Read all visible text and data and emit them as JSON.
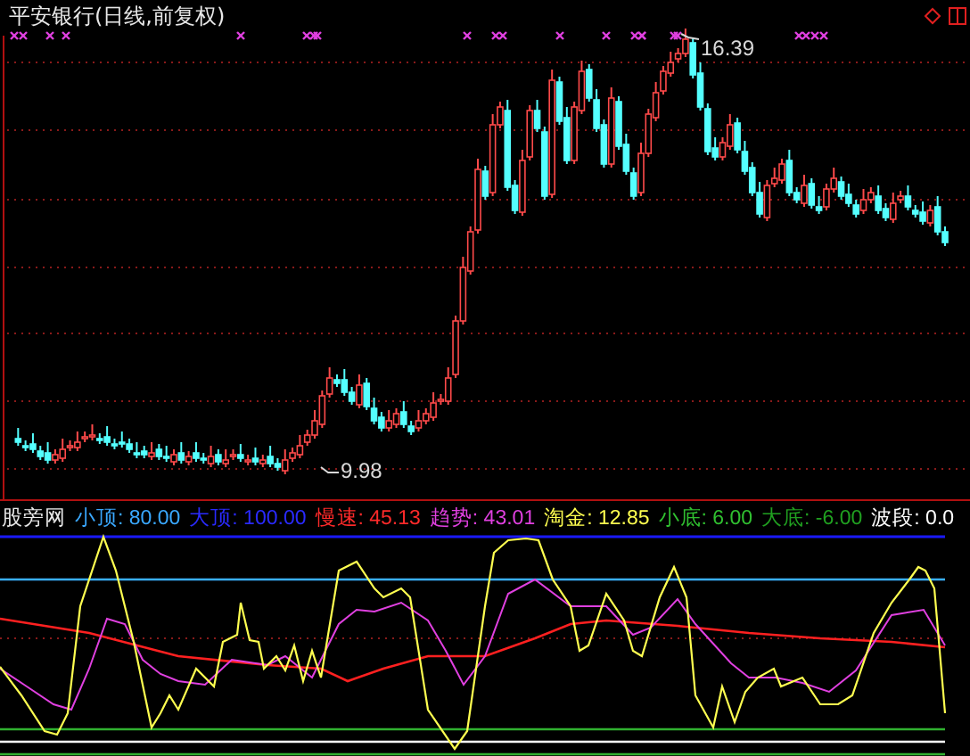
{
  "price_panel": {
    "title": "平安银行(日线,前复权)",
    "high_label": "16.39",
    "low_label": "9.98"
  },
  "indicator_panel": {
    "legend": [
      {
        "text": "股旁网",
        "color": "#e8e8e8"
      },
      {
        "text": "小顶: 80.00",
        "color": "#3aa8ff"
      },
      {
        "text": "大顶: 100.00",
        "color": "#2a2aff"
      },
      {
        "text": "慢速: 45.13",
        "color": "#ff2a2a"
      },
      {
        "text": "趋势: 43.01",
        "color": "#e040e0"
      },
      {
        "text": "淘金: 12.85",
        "color": "#ffff50"
      },
      {
        "text": "小底: 6.00",
        "color": "#30c030"
      },
      {
        "text": "大底: -6.00",
        "color": "#20a020"
      },
      {
        "text": "波段: 0.0",
        "color": "#ffffff"
      }
    ]
  }
}
